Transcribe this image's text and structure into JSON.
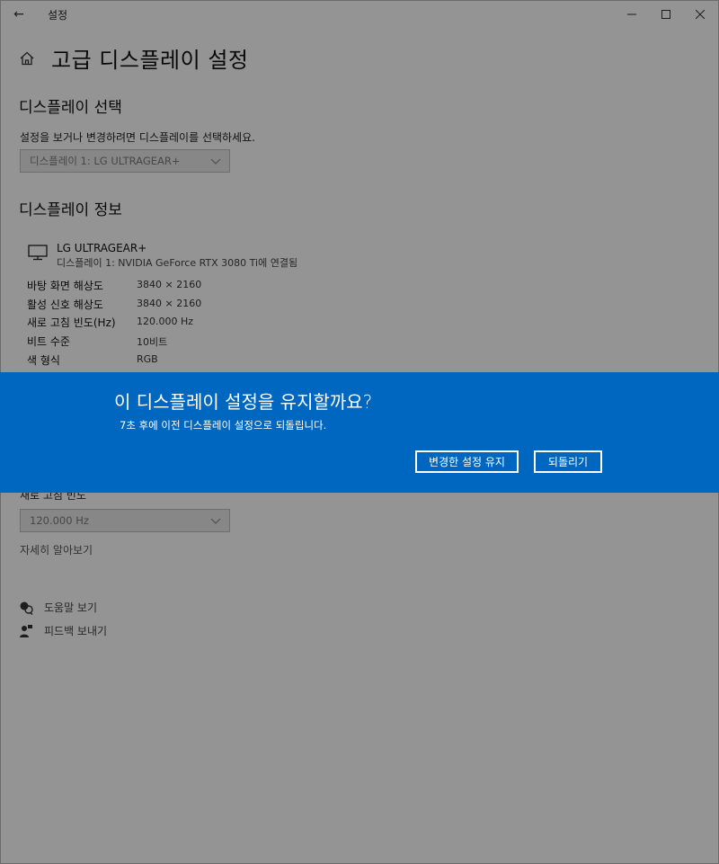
{
  "window": {
    "title": "설정",
    "back_icon": "←"
  },
  "page": {
    "title": "고급 디스플레이 설정"
  },
  "display_select": {
    "section_title": "디스플레이 선택",
    "description": "설정을 보거나 변경하려면 디스플레이를 선택하세요.",
    "dropdown_value": "디스플레이 1: LG ULTRAGEAR+"
  },
  "display_info": {
    "section_title": "디스플레이 정보",
    "monitor_name": "LG ULTRAGEAR+",
    "monitor_sub": "디스플레이 1: NVIDIA GeForce RTX 3080 Ti에 연결됨",
    "rows": [
      {
        "label": "바탕 화면 해상도",
        "value": "3840 × 2160"
      },
      {
        "label": "활성 신호 해상도",
        "value": "3840 × 2160"
      },
      {
        "label": "새로 고침 빈도(Hz)",
        "value": "120.000 Hz"
      },
      {
        "label": "비트 수준",
        "value": "10비트"
      },
      {
        "label": "색 형식",
        "value": "RGB"
      }
    ]
  },
  "refresh": {
    "section_label": "새로 고침 빈도",
    "dropdown_value": "120.000 Hz",
    "learn_more": "자세히 알아보기"
  },
  "help": {
    "get_help": "도움말 보기",
    "feedback": "피드백 보내기"
  },
  "dialog": {
    "title": "이 디스플레이 설정을 유지할까요?",
    "message": "7초 후에 이전 디스플레이 설정으로 되돌립니다.",
    "keep_label": "변경한 설정 유지",
    "revert_label": "되돌리기"
  },
  "colors": {
    "dialog_bg": "#0067c0",
    "overlay": "rgba(0,0,0,0.42)"
  }
}
